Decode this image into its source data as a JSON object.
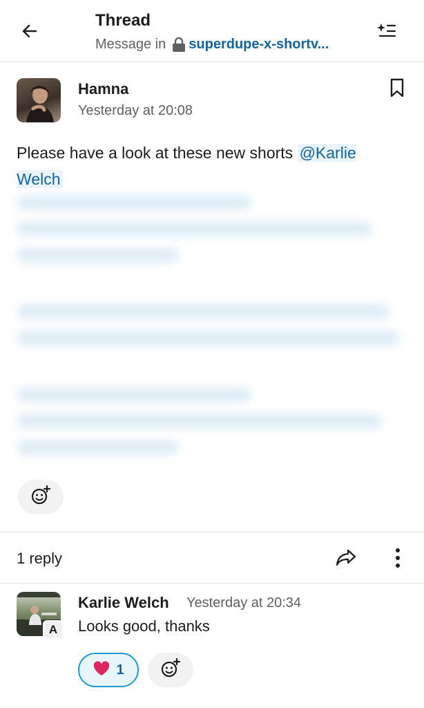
{
  "header": {
    "title": "Thread",
    "subtitle_prefix": "Message in",
    "channel": "superdupe-x-shortv..."
  },
  "icons": {
    "back": "arrow-left-icon",
    "lock": "lock-icon",
    "summary": "sparkle-list-icon",
    "bookmark": "bookmark-icon",
    "add_reaction": "emoji-add-icon",
    "share": "share-arrow-icon",
    "more": "more-vertical-icon",
    "heart": "heart-emoji"
  },
  "colors": {
    "link": "#1264a3",
    "mention_bg": "#e8f3fa",
    "reaction_border": "#1d9bd1",
    "heart": "#e0245e"
  },
  "message": {
    "author": "Hamna",
    "timestamp": "Yesterday at 20:08",
    "text": "Please have a look at these new shorts ",
    "mention": "@Karlie Welch"
  },
  "thread": {
    "reply_count": "1 reply"
  },
  "reply": {
    "author": "Karlie Welch",
    "timestamp": "Yesterday at 20:34",
    "avatar_badge": "A",
    "text": "Looks good, thanks",
    "reaction_count": "1"
  }
}
